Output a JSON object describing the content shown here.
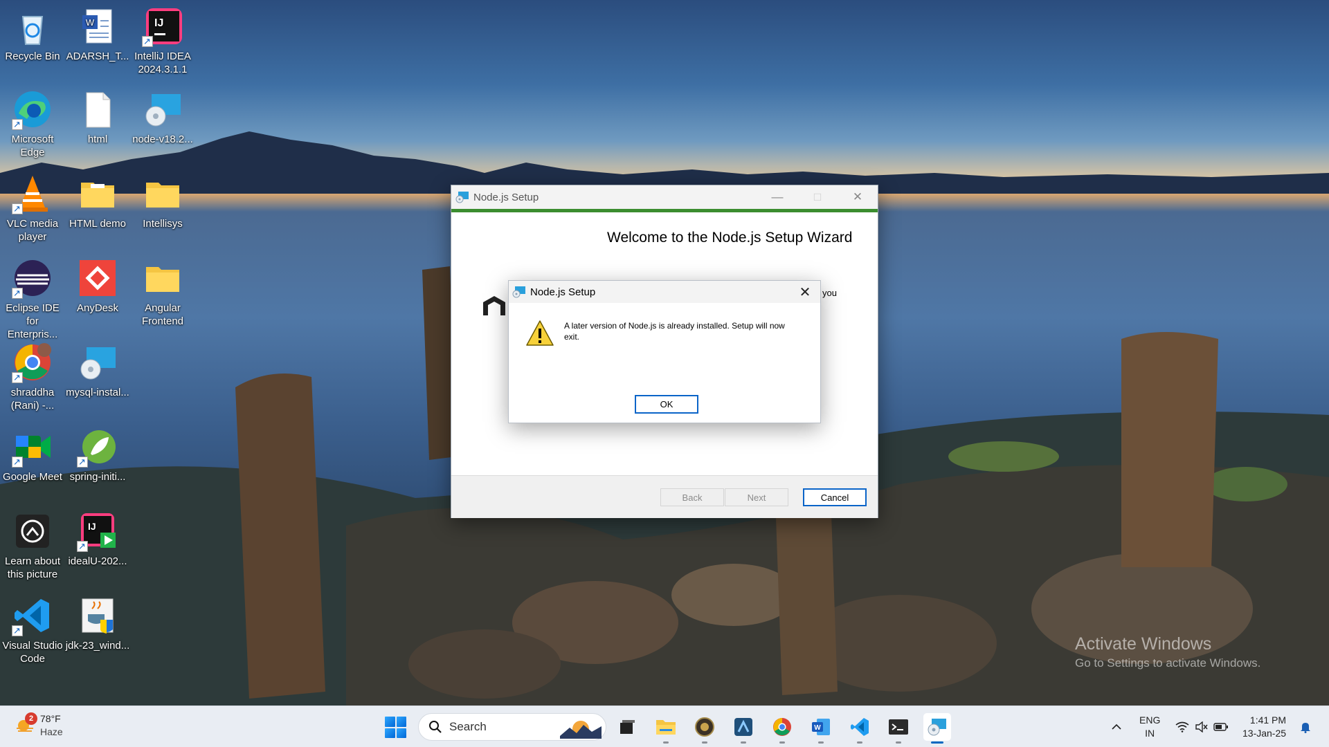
{
  "desktop": {
    "icons": [
      {
        "label": "Recycle Bin"
      },
      {
        "label": "ADARSH_T..."
      },
      {
        "label": "IntelliJ IDEA 2024.3.1.1"
      },
      {
        "label": "Microsoft Edge"
      },
      {
        "label": "html"
      },
      {
        "label": "node-v18.2..."
      },
      {
        "label": "VLC media player"
      },
      {
        "label": "HTML demo"
      },
      {
        "label": "Intellisys"
      },
      {
        "label": "Eclipse IDE for Enterpris..."
      },
      {
        "label": "AnyDesk"
      },
      {
        "label": "Angular Frontend"
      },
      {
        "label": "shraddha (Rani) -..."
      },
      {
        "label": "mysql-instal..."
      },
      {
        "label": "Google Meet"
      },
      {
        "label": "spring-initi..."
      },
      {
        "label": "Learn about this picture"
      },
      {
        "label": "idealU-202..."
      },
      {
        "label": "Visual Studio Code"
      },
      {
        "label": "jdk-23_wind..."
      }
    ],
    "activate": {
      "line1": "Activate Windows",
      "line2": "Go to Settings to activate Windows."
    }
  },
  "setup_window": {
    "title": "Node.js Setup",
    "welcome": "Welcome to the Node.js Setup Wizard",
    "partial_text": "you",
    "buttons": {
      "back": "Back",
      "next": "Next",
      "cancel": "Cancel"
    },
    "accent": "#3b8d2f"
  },
  "dialog": {
    "title": "Node.js Setup",
    "message": "A later version of Node.js is already installed. Setup will now exit.",
    "ok": "OK",
    "icon": "warning-icon"
  },
  "taskbar": {
    "weather": {
      "badge": "2",
      "temp": "78°F",
      "condition": "Haze"
    },
    "search": {
      "label": "Search"
    },
    "apps": [
      "task-view",
      "file-explorer",
      "app-circle",
      "app-blue",
      "chrome",
      "word",
      "vscode",
      "terminal",
      "node-setup"
    ],
    "language": {
      "line1": "ENG",
      "line2": "IN"
    },
    "clock": {
      "time": "1:41 PM",
      "date": "13-Jan-25"
    }
  }
}
